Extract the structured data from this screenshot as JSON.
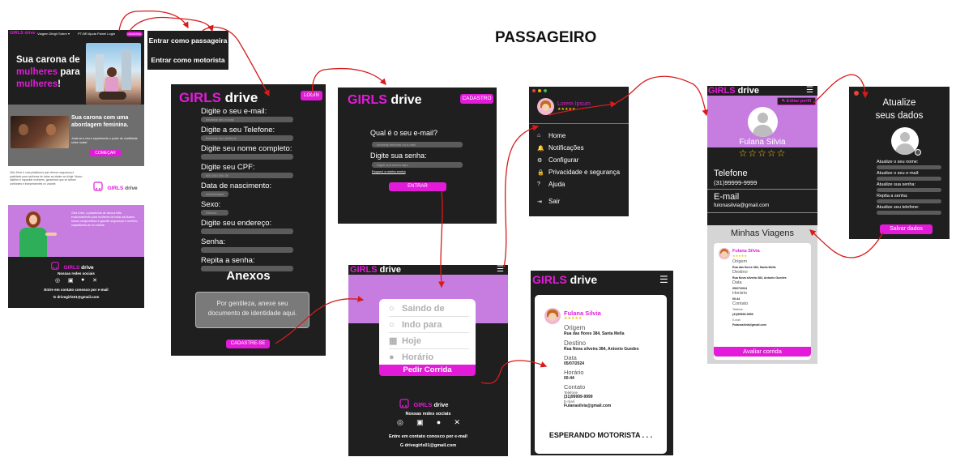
{
  "title": "PASSAGEIRO",
  "brand": {
    "girls": "GIRLS",
    "drive": " drive"
  },
  "role_buttons": {
    "passenger": "Entrar como passageira",
    "driver": "Entrar como motorista"
  },
  "landing": {
    "nav_brand": "GIRLS drive",
    "nav_links": "Viagem Dirigir Sobre ▾",
    "nav_right": "PT-BR  Ajuda  Painel  Login",
    "nav_cta": "CADASTRE-SE",
    "hero_line1": "Sua carona de",
    "hero_line2a": "mulheres",
    "hero_line2b": " para",
    "hero_line3a": "mulheres",
    "hero_line3b": "!",
    "sec2_title_a": "Sua carona ",
    "sec2_title_b": "com uma abordagem feminina.",
    "sec2_sub": "Junte-se a nós e experimente o poder de mobilidade sobre rodas!",
    "sec2_cta": "COMEÇAR",
    "about_text": "Girls Drive é uma plataforma que oferece segurança e qualidade para mulheres de todas as idades ao dirigir. Nosso objetivo é capacitar mulheres, garantindo que se sintam confiantes e independentes no volante.",
    "promo_text": "Girls Drive, a plataforma de carona feita exclusivamente para mulheres de todas as idades. Nosso compromisso é garantir segurança e conforto, capacitando-as no volante.",
    "footer_social": "Nossas redes sociais",
    "footer_contact": "Entre em contato conosco por e-mail",
    "footer_email": "drivegirls01@gmail.com"
  },
  "signup": {
    "login_btn": "LOGIN",
    "labels": [
      "Digite o seu e-mail:",
      "Digite a seu Telefone:",
      "Digite seu nome completo:",
      "Digite seu CPF:",
      "Data de nascimento:",
      "Sexo:",
      "Digite seu endereço:",
      "Senha:",
      "Repita a senha:"
    ],
    "placeholders": [
      "Informar seu e-mail",
      "Informar seu telefone",
      "",
      "000.000.000-00",
      "dd/mm/aaaa",
      "Gênero",
      "",
      "",
      ""
    ],
    "anexos_title": "Anexos",
    "anexos_text": "Por gentileza, anexe seu documento de identidade aqui.",
    "submit": "CADASTRE-SE"
  },
  "login": {
    "cadastro_btn": "CADASTRO",
    "q_email": "Qual é o seu e-mail?",
    "email_ph": "Informar telefone ou e-mail",
    "q_pass": "Digite sua senha:",
    "pass_ph": "Digite sua senha aqui",
    "forgot": "Esqueci a minha senha",
    "enter": "ENTRAR"
  },
  "menu": {
    "user": "Lorem Ipsum",
    "rating": "★★★★★",
    "items": [
      "Home",
      "Notificações",
      "Configurar",
      "Privacidade e segurança",
      "Ajuda",
      "Sair"
    ]
  },
  "ride": {
    "fields": [
      "Saindo de",
      "Indo para",
      "Hoje",
      "Horário"
    ],
    "cta": "Pedir Corrida",
    "footer_social": "Nossas redes sociais",
    "footer_contact": "Entre em contato conosco por e-mail",
    "footer_email": "drivegirls01@gmail.com"
  },
  "waiting": {
    "name": "Fulana Silvia",
    "rating": "★★★★★",
    "origem_l": "Origem",
    "origem_v": "Rua das flores 384, Santa Mella",
    "destino_l": "Destino",
    "destino_v": "Rua Nova silveira 384, Antonio Guedes",
    "data_l": "Data",
    "data_v": "05/07/2024",
    "hora_l": "Horário",
    "hora_v": "00:44",
    "contato_l": "Contato",
    "tel_l": "Telefone",
    "tel_v": "(31)99999-9999",
    "email_l": "E-mail",
    "email_v": "Fulanasilvia@gmail.com",
    "status": "ESPERANDO MOTORISTA . . ."
  },
  "profile": {
    "edit": "Editar perfil",
    "name": "Fulana Silvia",
    "rating": "☆☆☆☆☆",
    "phone_l": "Telefone",
    "phone_v": "(31)99999-9999",
    "email_l": "E-mail",
    "email_v": "fulonasilvia@gmail.com",
    "trips_title": "Minhas Viagens",
    "trip": {
      "name": "Fulana Silvia",
      "rating": "★★★★★",
      "origem_l": "Origem",
      "origem_v": "Rua das flores 384, Santa Mella",
      "destino_l": "Destino",
      "destino_v": "Rua Nova silveira 384, Antonio Guedes",
      "data_l": "Data",
      "data_v": "05/07/2024",
      "hora_l": "Horário",
      "hora_v": "00:44",
      "contato_l": "Contato",
      "tel_l": "Telefone",
      "tel_v": "(31)99999-9999",
      "email_l": "E-mail",
      "email_v": "Fulanasilvia@gmail.com"
    },
    "rate_btn": "Avaliar corrida"
  },
  "update": {
    "title1": "Atualize",
    "title2": "seus dados",
    "labels": [
      "Atualize o seu nome:",
      "Atualize o seu e-mail:",
      "Atualize sua senha:",
      "Repita a senha:",
      "Atualize seu telefone:"
    ],
    "save": "Salvar dados"
  },
  "colors": {
    "magenta": "#e21bd8",
    "lilac": "#c77de0",
    "dark": "#1f1f1f",
    "arrow": "#d61c1c"
  }
}
